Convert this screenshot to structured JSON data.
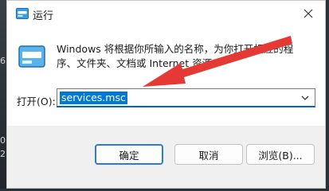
{
  "dialog": {
    "title": "运行",
    "description": "Windows 将根据你所输入的名称，为你打开相应的程序、文件夹、文档或 Internet 资源。",
    "open_label": "打开(O):",
    "open_value": "services.msc",
    "buttons": {
      "ok": "确定",
      "cancel": "取消",
      "browse": "浏览(B)..."
    }
  },
  "background": {
    "fragments": [
      "6",
      "0",
      "2"
    ]
  },
  "colors": {
    "accent": "#0078d7",
    "arrow": "#e53935",
    "dialog_bg": "#f0f0f0"
  },
  "icons": {
    "title": "run-icon",
    "close": "close-icon",
    "dropdown": "chevron-down-icon"
  }
}
